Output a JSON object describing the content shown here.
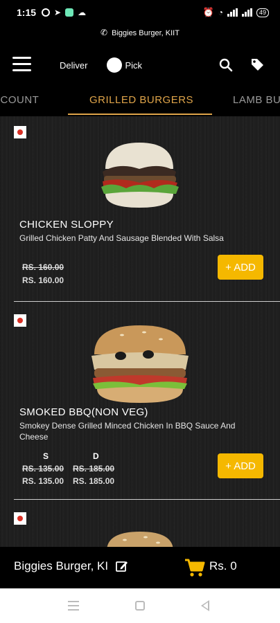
{
  "status_bar": {
    "time": "1:15",
    "battery": "49"
  },
  "store_line": {
    "text": "Biggies Burger, KIIT"
  },
  "header": {
    "deliver_label": "Deliver",
    "pick_label": "Pick"
  },
  "tabs": [
    {
      "label": "DISCOUNT"
    },
    {
      "label": "GRILLED BURGERS",
      "active": true
    },
    {
      "label": "LAMB BURGERS"
    }
  ],
  "products": [
    {
      "name": "CHICKEN SLOPPY",
      "description": "Grilled Chicken Patty And Sausage Blended With Salsa",
      "old_price": "RS. 160.00",
      "price": "RS. 160.00",
      "add_label": "+ ADD"
    },
    {
      "name": "SMOKED BBQ(NON VEG)",
      "description": "Smokey Dense Grilled Minced Chicken In BBQ Sauce And Cheese",
      "sizes": [
        {
          "label": "S",
          "old_price": "RS. 135.00",
          "price": "RS. 135.00"
        },
        {
          "label": "D",
          "old_price": "RS. 185.00",
          "price": "RS. 185.00"
        }
      ],
      "add_label": "+ ADD"
    }
  ],
  "bottom_bar": {
    "store": "Biggies Burger, KI",
    "cart_total": "Rs. 0"
  },
  "colors": {
    "accent": "#e0a54a",
    "add_button": "#f5b800",
    "non_veg_dot": "#d93025"
  }
}
